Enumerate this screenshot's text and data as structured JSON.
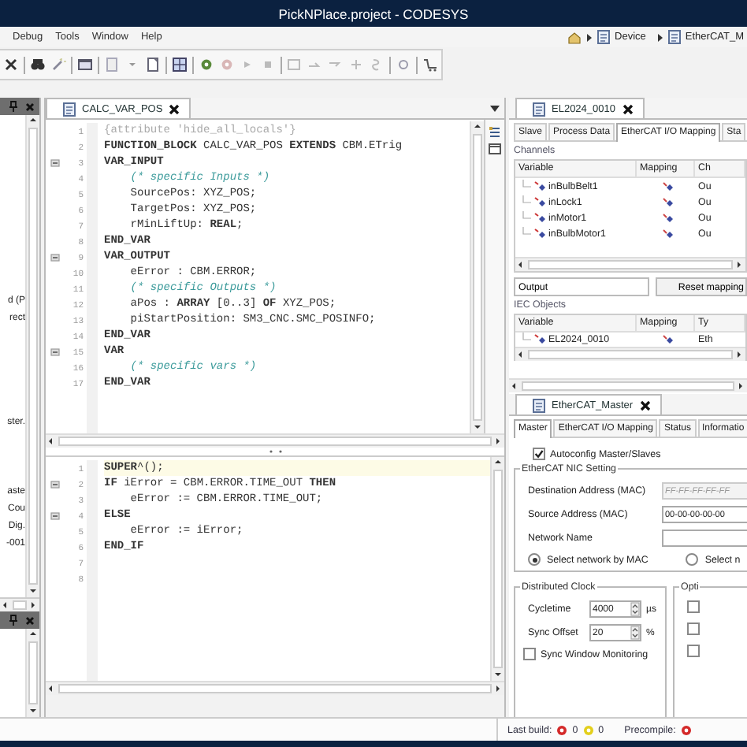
{
  "window": {
    "title": "PickNPlace.project - CODESYS"
  },
  "menu": [
    "Debug",
    "Tools",
    "Window",
    "Help"
  ],
  "breadcrumb": [
    "Device",
    "EtherCAT_M"
  ],
  "left_panel": {
    "groups": [
      {
        "lines": [
          "d (P",
          "rect"
        ]
      },
      {
        "lines": [
          "ster."
        ]
      },
      {
        "lines": [
          "aste",
          "Cou",
          "Dig.",
          "-001"
        ]
      }
    ]
  },
  "editor": {
    "tab": {
      "title": "CALC_VAR_POS",
      "selected": true
    },
    "declaration": [
      {
        "number": "1",
        "kind": "pragma",
        "text": "{attribute 'hide_all_locals'}",
        "foldable": false
      },
      {
        "number": "2",
        "kind": "code",
        "text": "**FUNCTION_BLOCK** CALC_VAR_POS **EXTENDS** CBM.ETrig",
        "foldable": false
      },
      {
        "number": "3",
        "kind": "code",
        "text": "**VAR_INPUT**",
        "foldable": true
      },
      {
        "number": "4",
        "kind": "comment",
        "text": "    (* specific Inputs *)",
        "foldable": false
      },
      {
        "number": "5",
        "kind": "code",
        "text": "    SourcePos: XYZ_POS;",
        "foldable": false
      },
      {
        "number": "6",
        "kind": "code",
        "text": "    TargetPos: XYZ_POS;",
        "foldable": false
      },
      {
        "number": "7",
        "kind": "code",
        "text": "    rMinLiftUp: **REAL**;",
        "foldable": false
      },
      {
        "number": "8",
        "kind": "code",
        "text": "**END_VAR**",
        "foldable": false
      },
      {
        "number": "9",
        "kind": "code",
        "text": "**VAR_OUTPUT**",
        "foldable": true
      },
      {
        "number": "10",
        "kind": "code",
        "text": "    eError : CBM.ERROR;",
        "foldable": false
      },
      {
        "number": "11",
        "kind": "comment",
        "text": "    (* specific Outputs *)",
        "foldable": false
      },
      {
        "number": "12",
        "kind": "code",
        "text": "    aPos : **ARRAY** [0..3] **OF** XYZ_POS;",
        "foldable": false
      },
      {
        "number": "13",
        "kind": "code",
        "text": "    piStartPosition: SM3_CNC.SMC_POSINFO;",
        "foldable": false
      },
      {
        "number": "14",
        "kind": "code",
        "text": "**END_VAR**",
        "foldable": false
      },
      {
        "number": "15",
        "kind": "code",
        "text": "**VAR**",
        "foldable": true
      },
      {
        "number": "16",
        "kind": "comment",
        "text": "    (* specific vars *)",
        "foldable": false
      },
      {
        "number": "17",
        "kind": "code",
        "text": "**END_VAR**",
        "foldable": false
      }
    ],
    "implementation": [
      {
        "number": "1",
        "kind": "code",
        "text": "**SUPER**^();",
        "foldable": false,
        "current": true
      },
      {
        "number": "2",
        "kind": "code",
        "text": "**IF** iError = CBM.ERROR.TIME_OUT **THEN**",
        "foldable": true,
        "current": false
      },
      {
        "number": "3",
        "kind": "code",
        "text": "    eError := CBM.ERROR.TIME_OUT;",
        "foldable": false,
        "current": false
      },
      {
        "number": "4",
        "kind": "code",
        "text": "**ELSE**",
        "foldable": true,
        "current": false
      },
      {
        "number": "5",
        "kind": "code",
        "text": "    eError := iError;",
        "foldable": false,
        "current": false
      },
      {
        "number": "6",
        "kind": "code",
        "text": "**END_IF**",
        "foldable": false,
        "current": false
      },
      {
        "number": "7",
        "foldable": false,
        "current": false
      },
      {
        "number": "8",
        "foldable": false,
        "current": false
      }
    ]
  },
  "device_editor": {
    "tab": {
      "title": "EL2024_0010",
      "selected": true
    },
    "subtabs": [
      {
        "label": "Slave",
        "selected": false
      },
      {
        "label": "Process Data",
        "selected": false
      },
      {
        "label": "EtherCAT I/O Mapping",
        "selected": true
      },
      {
        "label": "Sta",
        "selected": false
      }
    ],
    "channels": {
      "title": "Channels",
      "columns": [
        "Variable",
        "Mapping",
        "Ch"
      ],
      "rows": [
        {
          "variable": "inBulbBelt1",
          "channel": "Ou"
        },
        {
          "variable": "inLock1",
          "channel": "Ou"
        },
        {
          "variable": "inMotor1",
          "channel": "Ou"
        },
        {
          "variable": "inBulbMotor1",
          "channel": "Ou"
        }
      ]
    },
    "filter": {
      "value": "Output"
    },
    "reset_button": "Reset mapping",
    "iec_objects": {
      "title": "IEC Objects",
      "columns": [
        "Variable",
        "Mapping",
        "Ty"
      ],
      "rows": [
        {
          "variable": "EL2024_0010",
          "type": "Eth"
        }
      ]
    }
  },
  "master_editor": {
    "tab": {
      "title": "EtherCAT_Master",
      "selected": true
    },
    "subtabs": [
      {
        "label": "Master",
        "selected": true
      },
      {
        "label": "EtherCAT I/O Mapping",
        "selected": false
      },
      {
        "label": "Status",
        "selected": false
      },
      {
        "label": "Informatio",
        "selected": false
      }
    ],
    "autoconfig": {
      "label": "Autoconfig Master/Slaves",
      "checked": true
    },
    "nic": {
      "title": "EtherCAT NIC Setting",
      "fields": [
        {
          "label": "Destination Address (MAC)",
          "value": "FF-FF-FF-FF-FF",
          "disabled": true
        },
        {
          "label": "Source Address (MAC)",
          "value": "00-00-00-00-00",
          "disabled": false
        },
        {
          "label": "Network Name",
          "disabled": false
        }
      ],
      "radios": [
        {
          "label": "Select network by MAC",
          "selected": true
        },
        {
          "label": "Select n",
          "selected": false
        }
      ]
    },
    "clock": {
      "title": "Distributed Clock",
      "spinners": [
        {
          "label": "Cycletime",
          "value": "4000",
          "unit": "µs"
        },
        {
          "label": "Sync Offset",
          "value": "20",
          "unit": "%"
        }
      ],
      "sync_window": {
        "label": "Sync Window Monitoring",
        "checked": false
      }
    },
    "options": {
      "title": "Opti",
      "checkboxes": [
        {
          "checked": false
        },
        {
          "checked": false
        },
        {
          "checked": false
        }
      ]
    }
  },
  "status_bar": {
    "last_build_label": "Last build:",
    "errors": "0",
    "warnings": "0",
    "precompile_label": "Precompile:"
  }
}
